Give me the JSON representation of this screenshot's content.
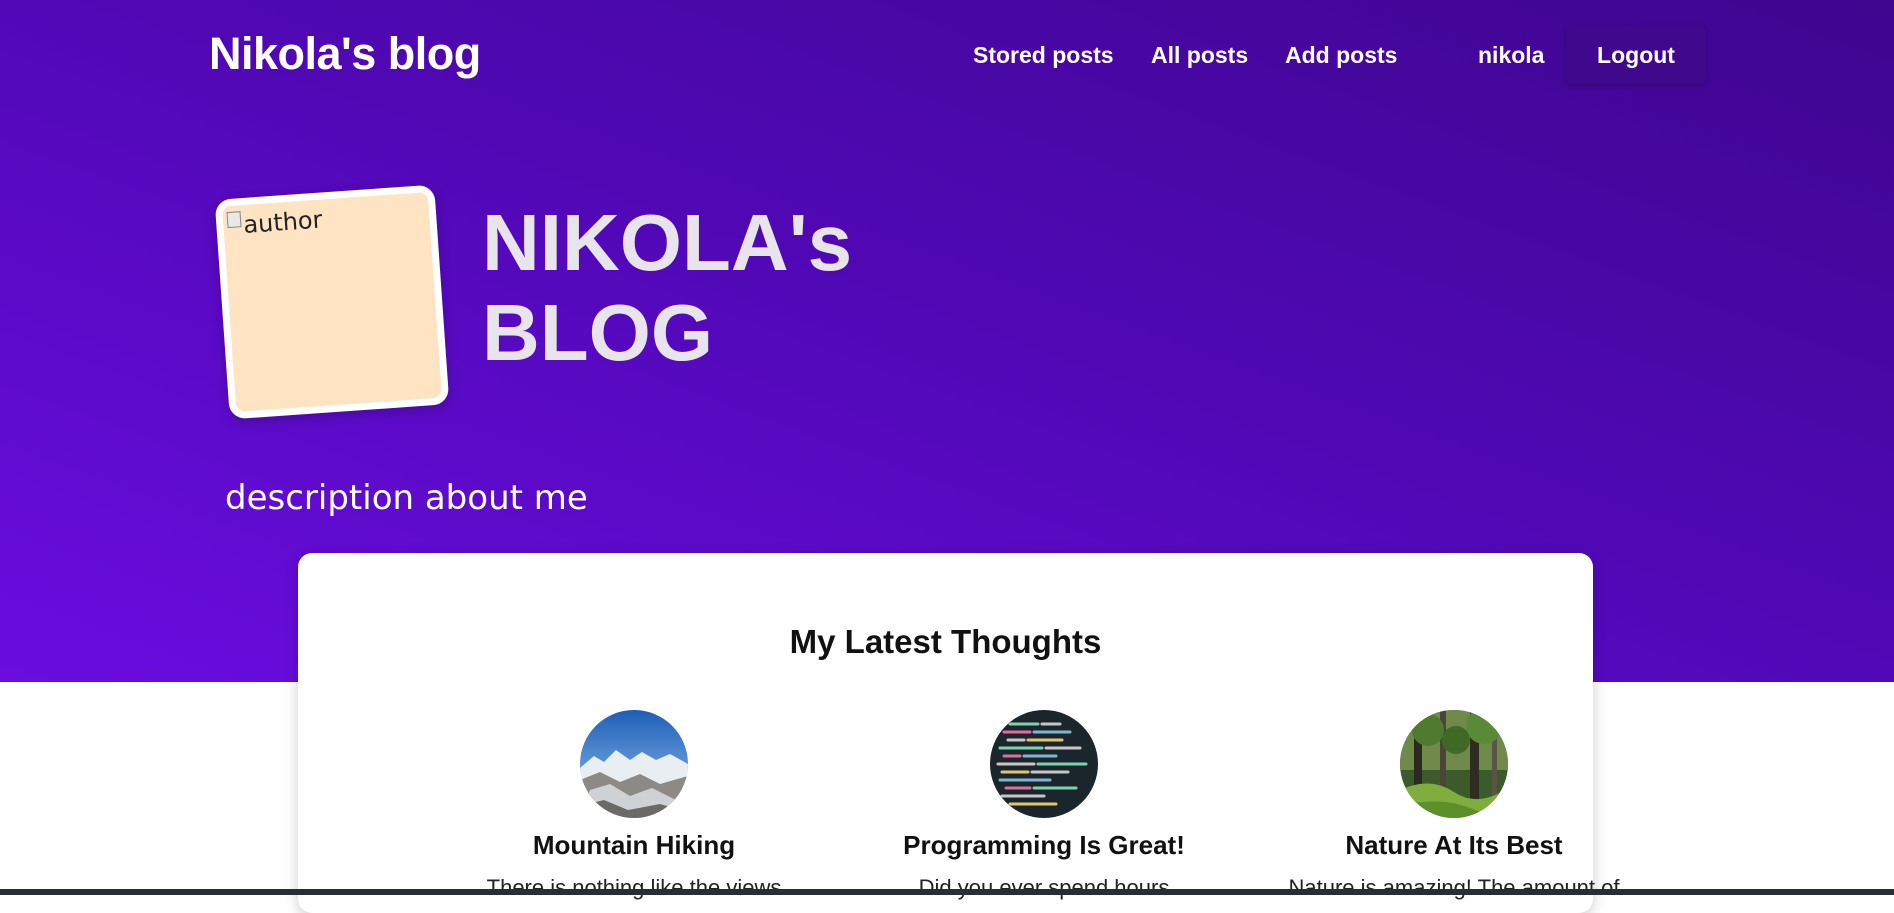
{
  "nav": {
    "brand": "Nikola's blog",
    "links": [
      {
        "label": "Stored posts"
      },
      {
        "label": "All posts"
      },
      {
        "label": "Add posts"
      }
    ],
    "username": "nikola",
    "logout_label": "Logout"
  },
  "hero": {
    "avatar_alt": "author",
    "title": "NIKOLA's BLOG",
    "description": "description about me"
  },
  "latest": {
    "heading": "My Latest Thoughts",
    "posts": [
      {
        "title": "Mountain Hiking",
        "snippet": "There is nothing like the views",
        "thumb_icon": "mountain-photo"
      },
      {
        "title": "Programming Is Great!",
        "snippet": "Did you ever spend hours",
        "thumb_icon": "code-photo"
      },
      {
        "title": "Nature At Its Best",
        "snippet": "Nature is amazing! The amount of",
        "thumb_icon": "forest-photo"
      }
    ]
  },
  "colors": {
    "hero_gradient_start": "#3f068f",
    "hero_gradient_end": "#6a0de0",
    "logout_bg": "#40088d",
    "avatar_bg": "#ffe4c4"
  }
}
